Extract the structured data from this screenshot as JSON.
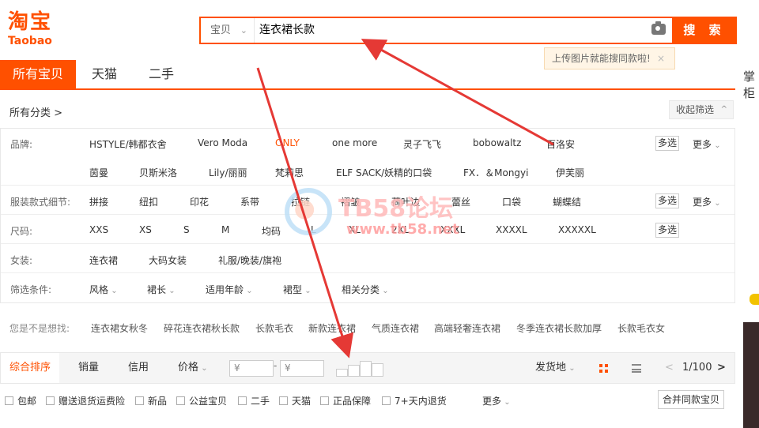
{
  "logo": {
    "cn": "淘宝",
    "en": "Taobao"
  },
  "search": {
    "scope": "宝贝",
    "query": "连衣裙长款",
    "button": "搜 索",
    "tip": "上传图片就能搜同款啦!",
    "tip_close": "×"
  },
  "tabs": [
    "所有宝贝",
    "天猫",
    "二手"
  ],
  "side_label": "掌柜",
  "category": {
    "title": "所有分类 >",
    "fold": "收起筛选",
    "fold_icon": "^"
  },
  "filters": {
    "brand_label": "品牌:",
    "brands_row1": [
      "HSTYLE/韩都衣舍",
      "Vero Moda",
      "ONLY",
      "one more",
      "灵子飞飞",
      "bobowaltz",
      "百洛安"
    ],
    "brands_row2": [
      "茵曼",
      "贝斯米洛",
      "Lily/丽丽",
      "梵莉思",
      "ELF SACK/妖精的口袋",
      "FX．＆Mongyi",
      "伊芙丽"
    ],
    "detail_label": "服装款式细节:",
    "details": [
      "拼接",
      "纽扣",
      "印花",
      "系带",
      "拉链",
      "褶皱",
      "荷叶边",
      "蕾丝",
      "口袋",
      "蝴蝶结"
    ],
    "size_label": "尺码:",
    "sizes": [
      "XXS",
      "XS",
      "S",
      "M",
      "均码",
      "L",
      "XL",
      "2XL",
      "XXXL",
      "XXXXL",
      "XXXXXL"
    ],
    "women_label": "女装:",
    "women": [
      "连衣裙",
      "大码女装",
      "礼服/晚装/旗袍"
    ],
    "cond_label": "筛选条件:",
    "conds": [
      "风格",
      "裙长",
      "适用年龄",
      "裙型",
      "相关分类"
    ],
    "multi": "多选",
    "more": "更多"
  },
  "watermark": {
    "t1": "TB58论坛",
    "t2": "www.tb58.net"
  },
  "suggestions": {
    "label": "您是不是想找:",
    "items": [
      "连衣裙女秋冬",
      "碎花连衣裙秋长款",
      "长款毛衣",
      "新款连衣裙",
      "气质连衣裙",
      "高端轻奢连衣裙",
      "冬季连衣裙长款加厚",
      "长款毛衣女"
    ]
  },
  "sortbar": {
    "sorts": [
      "综合排序",
      "销量",
      "信用",
      "价格"
    ],
    "price_from": "¥",
    "price_to": "¥",
    "dash": "-",
    "ship": "发货地",
    "page": "1/100",
    "prev": "<",
    "next": ">"
  },
  "checks": [
    "包邮",
    "赠送退货运费险",
    "新品",
    "公益宝贝",
    "二手",
    "天猫",
    "正品保障",
    "7+天内退货"
  ],
  "checks_more": "更多",
  "merge": "合并同款宝贝",
  "colors": {
    "accent": "#ff5000",
    "arrow": "#e53935"
  }
}
